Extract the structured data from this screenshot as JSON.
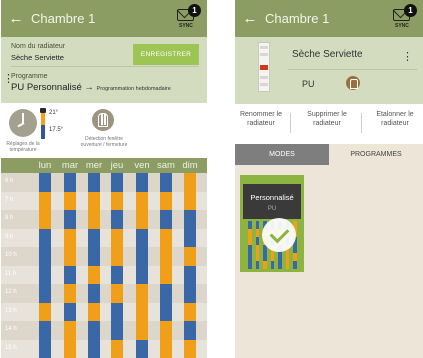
{
  "left": {
    "header": {
      "back_icon": "arrow-left-icon",
      "title": "Chambre 1",
      "sync_badge": "1",
      "sync_label": "SYNC"
    },
    "radiator": {
      "name_label": "Nom du radiateur",
      "name_value": "Sèche Serviette",
      "save_label": "ENREGISTRER"
    },
    "program": {
      "label": "Programme",
      "name": "PU Personnalisé",
      "arrow": " → ",
      "sub": "Programmation hebdomadaire"
    },
    "controls": {
      "temp_high": "21°",
      "temp_low": "17.5°",
      "regulation_label": "Réglages de la température",
      "detection_label": "Détection fenêtre ouverture / fermeture"
    },
    "days": [
      "lun",
      "mar",
      "mer",
      "jeu",
      "ven",
      "sam",
      "dim"
    ],
    "hours": [
      "6 h",
      "7 h",
      "8 h",
      "9 h",
      "10 h",
      "11 h",
      "12 h",
      "13 h",
      "14 h",
      "15 h"
    ],
    "schedule_colors": {
      "comfort": "#f0a018",
      "eco": "#3a68a6"
    },
    "schedule": [
      [
        "eco",
        "eco",
        "eco",
        "eco",
        "eco",
        "eco",
        "comfort"
      ],
      [
        "comfort",
        "comfort",
        "comfort",
        "comfort",
        "comfort",
        "comfort",
        "comfort"
      ],
      [
        "comfort",
        "eco",
        "comfort",
        "eco",
        "comfort",
        "eco",
        "eco"
      ],
      [
        "eco",
        "comfort",
        "eco",
        "comfort",
        "eco",
        "comfort",
        "eco"
      ],
      [
        "eco",
        "comfort",
        "eco",
        "comfort",
        "eco",
        "comfort",
        "comfort"
      ],
      [
        "eco",
        "eco",
        "comfort",
        "eco",
        "eco",
        "comfort",
        "eco"
      ],
      [
        "eco",
        "comfort",
        "eco",
        "comfort",
        "comfort",
        "eco",
        "eco"
      ],
      [
        "comfort",
        "eco",
        "comfort",
        "eco",
        "comfort",
        "eco",
        "comfort"
      ],
      [
        "eco",
        "comfort",
        "eco",
        "eco",
        "comfort",
        "comfort",
        "eco"
      ],
      [
        "eco",
        "comfort",
        "eco",
        "comfort",
        "eco",
        "comfort",
        "comfort"
      ]
    ]
  },
  "right": {
    "header": {
      "back_icon": "arrow-left-icon",
      "title": "Chambre 1",
      "sync_badge": "1",
      "sync_label": "SYNC"
    },
    "radiator": {
      "name": "Sèche Serviette",
      "program": "PU"
    },
    "actions": {
      "rename": "Renommer le radiateur",
      "delete": "Supprimer le radiateur",
      "calibrate": "Etalonner le radiateur"
    },
    "tabs": {
      "modes": "MODES",
      "programs": "PROGRAMMES"
    },
    "card": {
      "title": "Personnalisé",
      "subtitle": "PU"
    }
  }
}
